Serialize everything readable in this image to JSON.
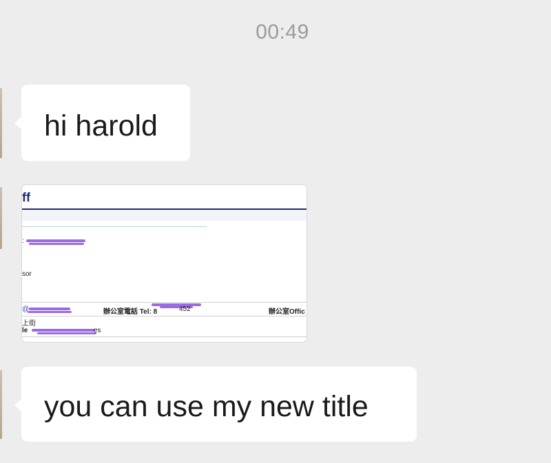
{
  "chat": {
    "timestamp": "00:49",
    "messages": [
      {
        "type": "text",
        "text": "hi harold"
      },
      {
        "type": "image",
        "document": {
          "header_text": "ff",
          "name_prefix": ":",
          "title_fragment": "sor",
          "email_prefix": "@",
          "office_tel_label": "辦公室電話 Tel: 8",
          "office_tel_suffix": "452",
          "office_label_right": "辦公室Offic",
          "address_fragment": "上街",
          "bottom_prefix": "le",
          "bottom_suffix": "es"
        }
      },
      {
        "type": "text",
        "text": "you can use my new title"
      }
    ]
  },
  "colors": {
    "background": "#ededed",
    "bubble": "#ffffff",
    "timestamp": "#9b9b9b",
    "doc_header_blue": "#1c2b7a",
    "redaction": "#8a4fe0"
  }
}
